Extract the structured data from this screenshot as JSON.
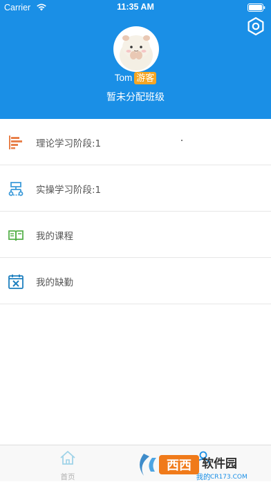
{
  "status_bar": {
    "carrier": "Carrier",
    "time": "11:35 AM"
  },
  "header": {
    "icon": "gear-icon",
    "user_name": "Tom",
    "user_badge": "游客",
    "class_status": "暂未分配班级"
  },
  "menu": {
    "items": [
      {
        "label": "理论学习阶段:1",
        "icon": "bar-chart-icon",
        "color": "#e8804a"
      },
      {
        "label": "实操学习阶段:1",
        "icon": "structure-icon",
        "color": "#3b9ad9"
      },
      {
        "label": "我的课程",
        "icon": "book-icon",
        "color": "#56b04a"
      },
      {
        "label": "我的缺勤",
        "icon": "calendar-x-icon",
        "color": "#1d7fbf"
      }
    ]
  },
  "tabbar": {
    "tabs": [
      {
        "label": "首页",
        "icon": "home-icon",
        "active": false
      },
      {
        "label": "我的",
        "icon": "user-icon",
        "active": true
      }
    ]
  },
  "watermark": {
    "brand": "西西",
    "suffix": "软件园",
    "url": "CR173.COM"
  },
  "colors": {
    "primary": "#1a8fe6",
    "badge": "#f5a623"
  }
}
